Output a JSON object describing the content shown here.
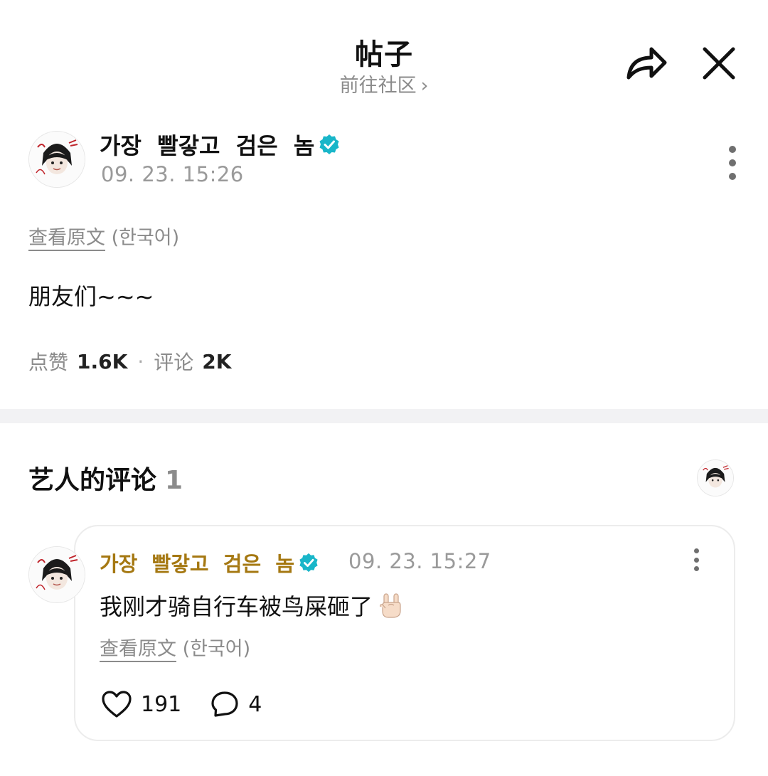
{
  "header": {
    "title": "帖子",
    "subtitle": "前往社区",
    "subtitle_chevron": "›",
    "share_icon": "share-arrow-icon",
    "close_icon": "close-icon"
  },
  "post": {
    "author": "가장  빨갛고  검은  놈",
    "verified_color": "#19b6c9",
    "time": "09. 23. 15:26",
    "translate_link": "查看原文",
    "translate_lang": "(한국어)",
    "body": "朋友们~~~",
    "likes_label": "点赞",
    "likes_count": "1.6K",
    "stats_separator": "·",
    "comments_label": "评论",
    "comments_count": "2K"
  },
  "artist_comments": {
    "title": "艺人的评论",
    "count": "1",
    "items": [
      {
        "author": "가장  빨갛고  검은  놈",
        "author_color": "#a57812",
        "time": "09. 23. 15:27",
        "body": "我刚才骑自行车被鸟屎砸了",
        "emoji_icon": "rock-on-hand-icon",
        "translate_link": "查看原文",
        "translate_lang": "(한국어)",
        "likes": "191",
        "replies": "4"
      }
    ]
  }
}
